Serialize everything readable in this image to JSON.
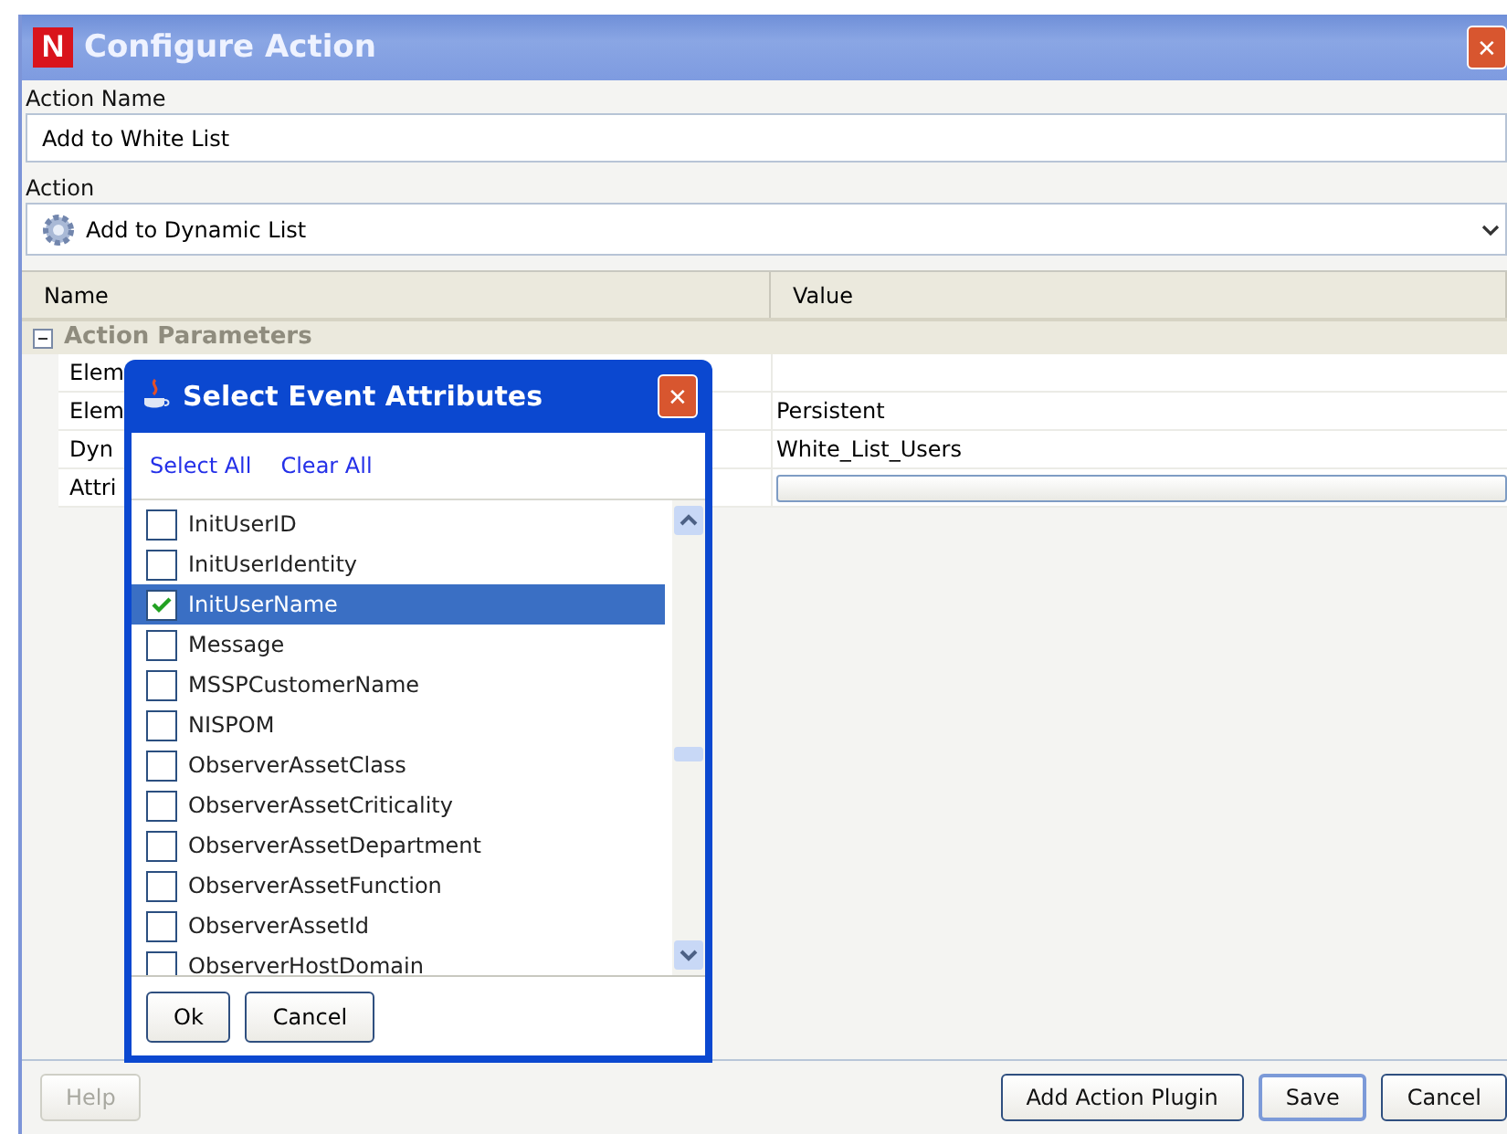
{
  "window": {
    "title": "Configure Action",
    "logo": "N",
    "close": "✕"
  },
  "action_name": {
    "label": "Action Name",
    "value": "Add to White List"
  },
  "action": {
    "label": "Action",
    "value": "Add to Dynamic List"
  },
  "table": {
    "columns": [
      "Name",
      "Value"
    ],
    "group": {
      "label": "Action Parameters",
      "expanded": true
    },
    "rows": [
      {
        "name": "Elem",
        "value": "",
        "kind": "text"
      },
      {
        "name": "Elem",
        "value": "Persistent",
        "kind": "text"
      },
      {
        "name": "Dyn",
        "value": "White_List_Users",
        "kind": "text"
      },
      {
        "name": "Attri",
        "value": "",
        "kind": "field"
      }
    ]
  },
  "buttons": [
    {
      "label": "Help",
      "disabled": true,
      "default": false
    },
    {
      "label": "Add Action Plugin",
      "disabled": false,
      "default": false
    },
    {
      "label": "Save",
      "disabled": false,
      "default": true
    },
    {
      "label": "Cancel",
      "disabled": false,
      "default": false
    }
  ],
  "dialog": {
    "title": "Select Event Attributes",
    "close": "✕",
    "links": [
      "Select All",
      "Clear All"
    ],
    "items": [
      {
        "label": "InitUserID",
        "checked": false,
        "selected": false
      },
      {
        "label": "InitUserIdentity",
        "checked": false,
        "selected": false
      },
      {
        "label": "InitUserName",
        "checked": true,
        "selected": true
      },
      {
        "label": "Message",
        "checked": false,
        "selected": false
      },
      {
        "label": "MSSPCustomerName",
        "checked": false,
        "selected": false
      },
      {
        "label": "NISPOM",
        "checked": false,
        "selected": false
      },
      {
        "label": "ObserverAssetClass",
        "checked": false,
        "selected": false
      },
      {
        "label": "ObserverAssetCriticality",
        "checked": false,
        "selected": false
      },
      {
        "label": "ObserverAssetDepartment",
        "checked": false,
        "selected": false
      },
      {
        "label": "ObserverAssetFunction",
        "checked": false,
        "selected": false
      },
      {
        "label": "ObserverAssetId",
        "checked": false,
        "selected": false
      },
      {
        "label": "ObserverHostDomain",
        "checked": false,
        "selected": false
      }
    ],
    "buttons": [
      "Ok",
      "Cancel"
    ]
  }
}
